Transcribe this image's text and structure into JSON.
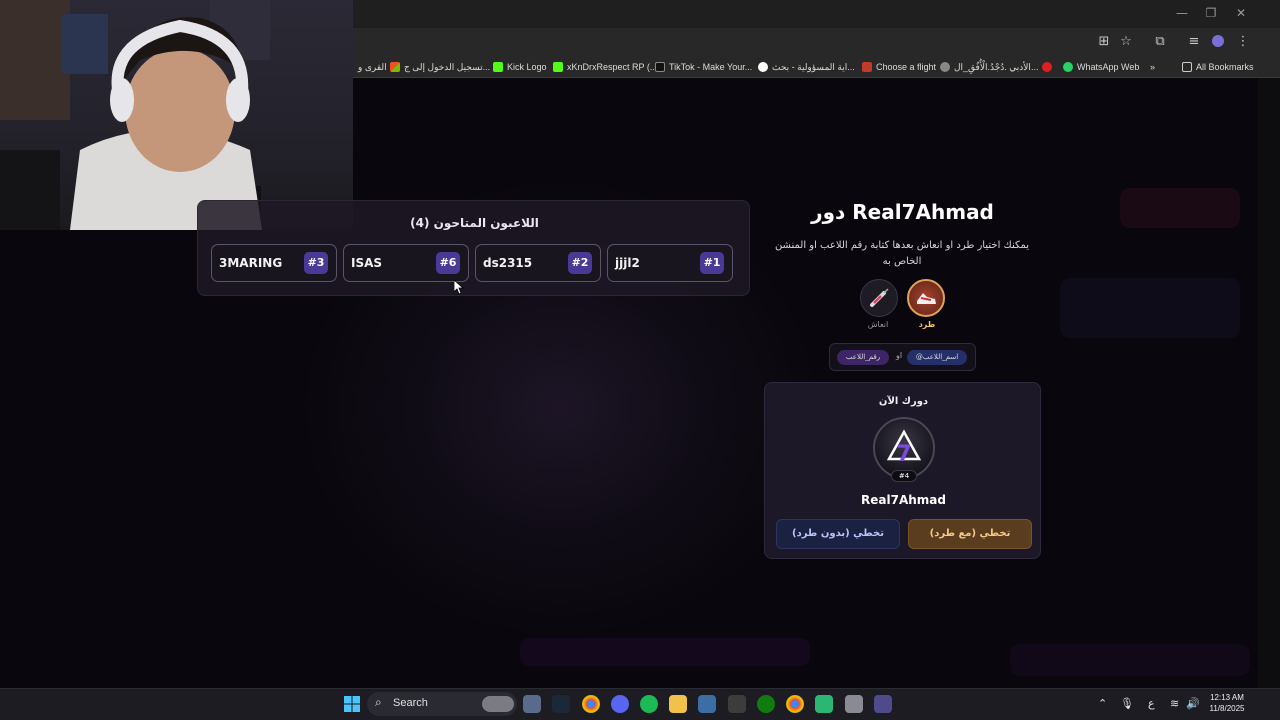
{
  "browser": {
    "bookmarks": [
      "القرى و",
      "تسجيل الدخول إلى ج...",
      "Kick Logo",
      "xKnDrxRespect RP (...",
      "TikTok - Make Your...",
      "اية المسؤولية - بحث...",
      "Choose a flight",
      "الأدبي .دُجْدُ.الْأُفُقِ_ال...",
      "WhatsApp Web"
    ],
    "more_bookmarks": "»",
    "all_bookmarks": "All Bookmarks",
    "window_controls": {
      "minimize": "—",
      "restore": "❐",
      "close": "✕"
    }
  },
  "players_panel": {
    "title": "اللاعبون المتاحون (4)",
    "players": [
      {
        "name": "3MARING",
        "rank": "#3"
      },
      {
        "name": "ISAS",
        "rank": "#6"
      },
      {
        "name": "ds2315",
        "rank": "#2"
      },
      {
        "name": "jjjl2",
        "rank": "#1"
      }
    ]
  },
  "turn": {
    "title": "دور Real7Ahmad",
    "description": "يمكنك اختيار طرد او انعاش بعدها كتابة رقم اللاعب او المنشن الخاص به",
    "actions": [
      {
        "label": "طرد",
        "icon": "sneaker-icon"
      },
      {
        "label": "انعاش",
        "icon": "syringe-icon"
      }
    ],
    "hint": {
      "chip_name": "@اسم_اللاعب",
      "or": "او",
      "chip_number": "رقم_اللاعب"
    }
  },
  "current_turn": {
    "title": "دورك الآن",
    "badge": "#4",
    "name": "Real7Ahmad",
    "buttons": {
      "with_kick": "تخطي (مع طرد)",
      "without_kick": "تخطي (بدون طرد)"
    }
  },
  "taskbar": {
    "search_label": "Search",
    "lang": "ع",
    "time": "12:13 AM",
    "date": "11/8/2025"
  },
  "colors": {
    "accent_purple": "#4a3a96",
    "kick_orange": "#e0a25a",
    "page_bg": "#0b0910"
  }
}
